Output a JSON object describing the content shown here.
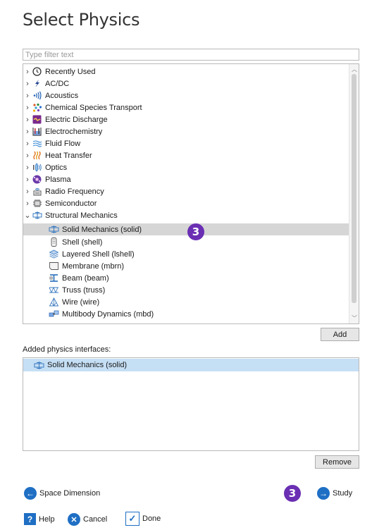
{
  "title": "Select Physics",
  "filter": {
    "placeholder": "Type filter text",
    "value": ""
  },
  "tree": {
    "items": [
      {
        "label": "Recently Used",
        "expanded": false,
        "icon": "clock-icon"
      },
      {
        "label": "AC/DC",
        "expanded": false,
        "icon": "lightning-icon"
      },
      {
        "label": "Acoustics",
        "expanded": false,
        "icon": "sound-waves-icon"
      },
      {
        "label": "Chemical Species Transport",
        "expanded": false,
        "icon": "dots-icon"
      },
      {
        "label": "Electric Discharge",
        "expanded": false,
        "icon": "discharge-icon"
      },
      {
        "label": "Electrochemistry",
        "expanded": false,
        "icon": "beaker-icon"
      },
      {
        "label": "Fluid Flow",
        "expanded": false,
        "icon": "flow-lines-icon"
      },
      {
        "label": "Heat Transfer",
        "expanded": false,
        "icon": "heat-icon"
      },
      {
        "label": "Optics",
        "expanded": false,
        "icon": "optics-icon"
      },
      {
        "label": "Plasma",
        "expanded": false,
        "icon": "plasma-icon"
      },
      {
        "label": "Radio Frequency",
        "expanded": false,
        "icon": "antenna-icon"
      },
      {
        "label": "Semiconductor",
        "expanded": false,
        "icon": "chip-icon"
      },
      {
        "label": "Structural Mechanics",
        "expanded": true,
        "icon": "structure-icon"
      }
    ],
    "children": [
      {
        "label": "Solid Mechanics (solid)",
        "icon": "solid-icon",
        "selected": true
      },
      {
        "label": "Shell (shell)",
        "icon": "shell-icon",
        "selected": false
      },
      {
        "label": "Layered Shell (lshell)",
        "icon": "layered-shell-icon",
        "selected": false
      },
      {
        "label": "Membrane (mbrn)",
        "icon": "membrane-icon",
        "selected": false
      },
      {
        "label": "Beam (beam)",
        "icon": "beam-icon",
        "selected": false
      },
      {
        "label": "Truss (truss)",
        "icon": "truss-icon",
        "selected": false
      },
      {
        "label": "Wire (wire)",
        "icon": "wire-icon",
        "selected": false
      },
      {
        "label": "Multibody Dynamics (mbd)",
        "icon": "multibody-icon",
        "selected": false
      }
    ]
  },
  "add_button": "Add",
  "added_section": {
    "label": "Added physics interfaces:",
    "items": [
      "Solid Mechanics (solid)"
    ]
  },
  "remove_button": "Remove",
  "badges": [
    "3",
    "3"
  ],
  "nav": {
    "back_label": "Space Dimension",
    "next_label": "Study"
  },
  "footer": {
    "help": "Help",
    "cancel": "Cancel",
    "done": "Done"
  },
  "colors": {
    "badge": "#6a2fb3",
    "selection": "#d6d6d6",
    "added_selection": "#c5dff5",
    "nav_circle": "#1f6fc4"
  }
}
